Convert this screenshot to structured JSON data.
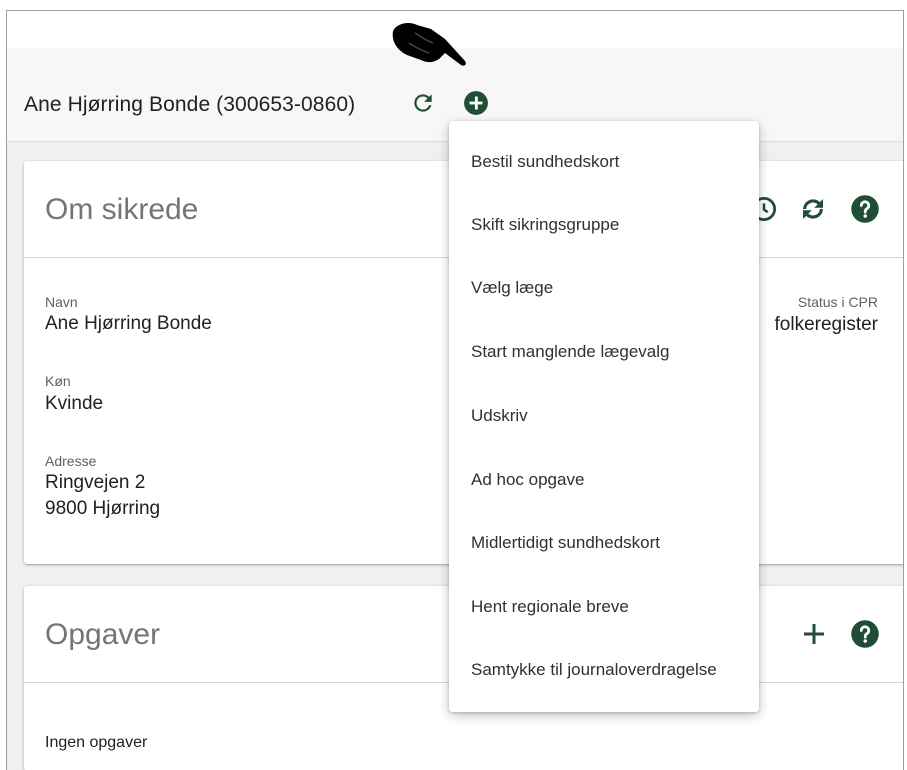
{
  "header": {
    "title": "Ane Hjørring Bonde (300653-0860)",
    "refresh_icon": "refresh-icon",
    "add_icon": "plus-circle-icon",
    "accent_color": "#1f4d35"
  },
  "about": {
    "title": "Om sikrede",
    "fields": [
      {
        "label": "Navn",
        "value": "Ane Hjørring Bonde"
      },
      {
        "label": "Køn",
        "value": "Kvinde"
      },
      {
        "label": "Adresse",
        "value_line1": "Ringvejen 2",
        "value_line2": "9800 Hjørring"
      }
    ],
    "status": {
      "label": "Status i CPR",
      "value": "folkeregister"
    },
    "icons": [
      "history-icon",
      "sync-icon",
      "help-icon"
    ]
  },
  "menu": {
    "items": [
      "Bestil sundhedskort",
      "Skift sikringsgruppe",
      "Vælg læge",
      "Start manglende lægevalg",
      "Udskriv",
      "Ad hoc opgave",
      "Midlertidigt sundhedskort",
      "Hent regionale breve",
      "Samtykke til journaloverdragelse"
    ]
  },
  "tasks": {
    "title": "Opgaver",
    "empty_text": "Ingen opgaver",
    "icons": [
      "plus-icon",
      "help-icon"
    ]
  }
}
